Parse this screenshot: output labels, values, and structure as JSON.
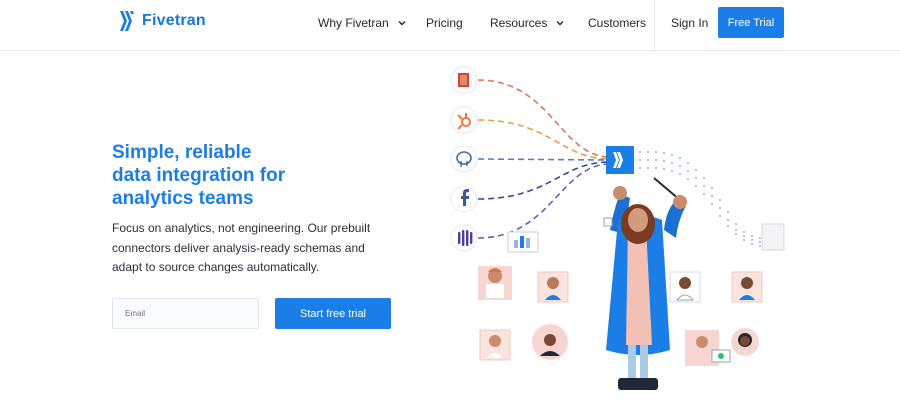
{
  "nav": {
    "brand": "Fivetran",
    "items": [
      {
        "label": "Why Fivetran",
        "has_dropdown": true
      },
      {
        "label": "Pricing",
        "has_dropdown": false
      },
      {
        "label": "Resources",
        "has_dropdown": true
      },
      {
        "label": "Customers",
        "has_dropdown": false
      }
    ],
    "sign_in": "Sign In",
    "cta": "Free Trial"
  },
  "hero": {
    "headline_lines": [
      "Simple, reliable",
      "data integration for",
      "analytics teams"
    ],
    "subtext_lines": [
      "Focus on analytics, not engineering. Our prebuilt",
      "connectors deliver analysis-ready schemas and",
      "adapt to source changes automatically."
    ],
    "email_placeholder": "Email",
    "cta": "Start free trial"
  },
  "illustration": {
    "connectors": [
      "office-icon",
      "hubspot-icon",
      "postgres-icon",
      "facebook-icon",
      "intercom-icon"
    ],
    "hub_icon": "fivetran-logo-icon",
    "colors": {
      "brand": "#1a7ee6",
      "line_red": "#e0745f",
      "line_orange": "#e8a04a",
      "line_blue": "#5a7fc6",
      "line_navy": "#3b4b8c",
      "line_purple": "#6b5fa8",
      "dots": "#8fb7e8"
    }
  }
}
